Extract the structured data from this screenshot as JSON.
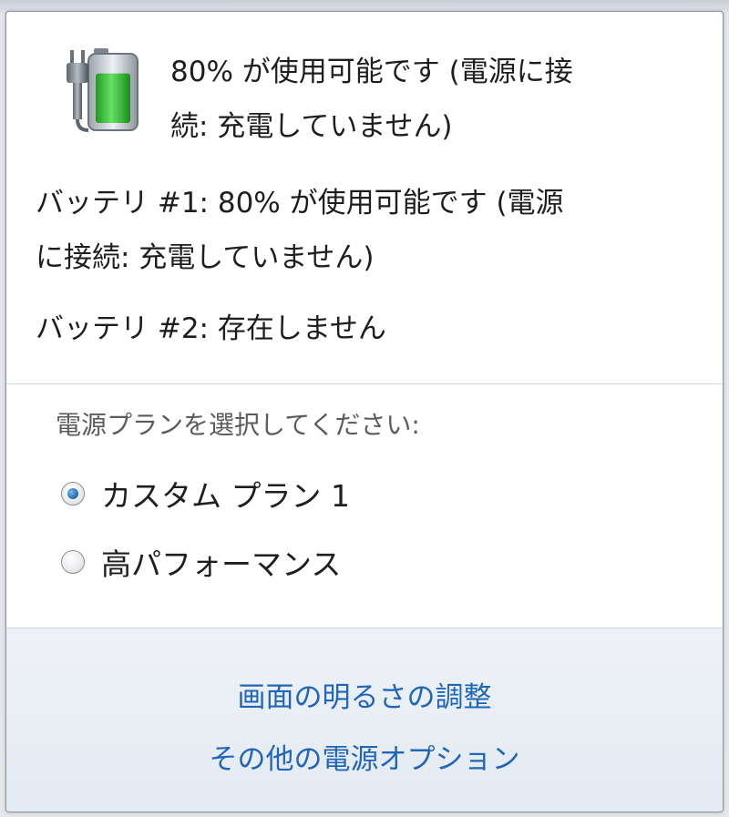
{
  "summary": {
    "status_line1": "80% が使用可能です (電源に接",
    "status_line2": "続: 充電していません)",
    "icon": "battery-plugged-icon",
    "battery_fill_percent": 80,
    "battery_fill_color": "#2fb82f"
  },
  "batteries": [
    {
      "line1": "バッテリ #1: 80% が使用可能です (電源",
      "line2": "に接続: 充電していません)"
    },
    {
      "line1": "バッテリ #2: 存在しません"
    }
  ],
  "plans": {
    "heading": "電源プランを選択してください:",
    "options": [
      {
        "label": "カスタム プラン 1",
        "selected": true
      },
      {
        "label": "高パフォーマンス",
        "selected": false
      }
    ]
  },
  "links": {
    "brightness": "画面の明るさの調整",
    "more_options": "その他の電源オプション"
  },
  "colors": {
    "link": "#1f66b8",
    "heading_gray": "#5b5b5b"
  }
}
